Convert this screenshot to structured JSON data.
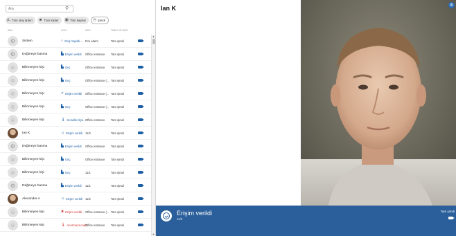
{
  "search": {
    "placeholder": "Ara"
  },
  "filters": [
    {
      "label": "Tüm olay tipleri",
      "icon": "⌂"
    },
    {
      "label": "Tüm kişiler",
      "icon": "👤"
    },
    {
      "label": "Tüm kapılar",
      "icon": "▥"
    },
    {
      "label": "Şimdi",
      "icon": "◷"
    }
  ],
  "columns": {
    "name": "İsim",
    "status": "Olay",
    "door": "Kapı",
    "date": "Tarih ve saat"
  },
  "rows": [
    {
      "avatar": "gear-icon",
      "name": "Sistem",
      "status": "Giriş Yapıldı –",
      "status_color": "#1e5fa6",
      "status_icon": "○",
      "door": "Fire alarm",
      "date": "Tam şimdi"
    },
    {
      "avatar": "gear-icon",
      "name": "Düğmeye basma",
      "status": "Erişim verildi",
      "status_color": "#1e5fa6",
      "status_icon": "▙",
      "door": "Office entrance",
      "date": "Tam şimdi"
    },
    {
      "avatar": "person-icon",
      "name": "Bilinmeyen kişi",
      "status": "Geç",
      "status_color": "#1e5fa6",
      "status_icon": "▙",
      "door": "Office entrance",
      "date": "Tam şimdi"
    },
    {
      "avatar": "person-icon",
      "name": "Bilinmeyen kişi",
      "status": "Geç",
      "status_color": "#1e5fa6",
      "status_icon": "▙",
      "door": "Office entrance (...",
      "date": "Tam şimdi"
    },
    {
      "avatar": "person-icon",
      "name": "Bilinmeyen kişi",
      "status": "Erişim verildi",
      "status_color": "#1e5fa6",
      "status_icon": "✔",
      "door": "Office entrance (...",
      "date": "Tam şimdi"
    },
    {
      "avatar": "person-icon",
      "name": "Bilinmeyen kişi",
      "status": "Geç",
      "status_color": "#1e5fa6",
      "status_icon": "▙",
      "door": "Office entrance (...",
      "date": "Tam şimdi"
    },
    {
      "avatar": "person-icon",
      "name": "Bilinmeyen kişi",
      "status": "Sıcaklık ölçü...",
      "status_color": "#1e5fa6",
      "status_icon": "🌡",
      "door": "Office entrance",
      "date": "Tam şimdi"
    },
    {
      "avatar": "photo",
      "name": "Ian K",
      "status": "Erişim verildi",
      "status_color": "#1e5fa6",
      "status_icon": "☺",
      "door": "11/2",
      "date": "Tam şimdi"
    },
    {
      "avatar": "gear-icon",
      "name": "Düğmeye basma",
      "status": "Erişim verildi",
      "status_color": "#1e5fa6",
      "status_icon": "▙",
      "door": "Office entrance",
      "date": "Tam şimdi"
    },
    {
      "avatar": "person-icon",
      "name": "Bilinmeyen kişi",
      "status": "Geç",
      "status_color": "#1e5fa6",
      "status_icon": "▙",
      "door": "Office entrance",
      "date": "Tam şimdi"
    },
    {
      "avatar": "person-icon",
      "name": "Bilinmeyen kişi",
      "status": "Geç",
      "status_color": "#1e5fa6",
      "status_icon": "▙",
      "door": "11/1",
      "date": "Tam şimdi"
    },
    {
      "avatar": "gear-icon",
      "name": "Düğmeye basma",
      "status": "Erişim verildi",
      "status_color": "#1e5fa6",
      "status_icon": "▙",
      "door": "11/1",
      "date": "Tam şimdi"
    },
    {
      "avatar": "photo",
      "name": "Alexander A",
      "status": "Erişim verildi",
      "status_color": "#1e5fa6",
      "status_icon": "☺",
      "door": "11/2",
      "date": "Tam şimdi"
    },
    {
      "avatar": "person-icon",
      "name": "Bilinmeyen kişi",
      "status": "Erişim verildi...",
      "status_color": "#d0312d",
      "status_icon": "✖",
      "door": "Office entrance (...",
      "date": "Tam şimdi"
    },
    {
      "avatar": "person-icon",
      "name": "Bilinmeyen kişi",
      "status": "Anormal sıcaklı...",
      "status_color": "#d0312d",
      "status_icon": "🌡",
      "door": "Office entrance",
      "date": "Tam şimdi"
    }
  ],
  "detail": {
    "name": "Ian K",
    "status_title": "Erişim verildi",
    "status_door": "11/2",
    "status_time": "Tam şimdi"
  },
  "colors": {
    "accent": "#2a5f9b",
    "camera": "#1e5fa6",
    "alert": "#d0312d"
  }
}
